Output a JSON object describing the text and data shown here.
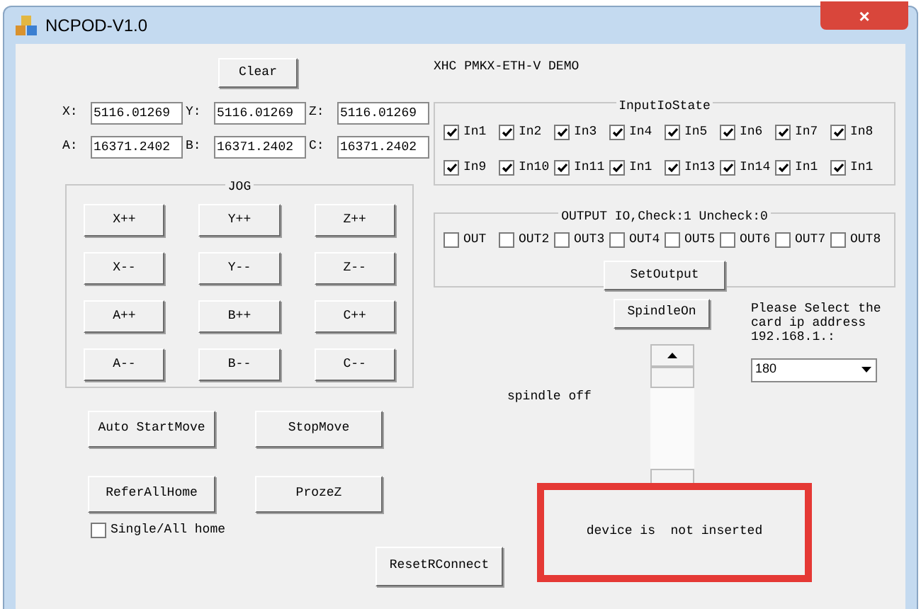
{
  "window": {
    "title": "NCPOD-V1.0",
    "close": "×"
  },
  "clear_button": "Clear",
  "positions": [
    {
      "label": "X:",
      "value": "5116.01269"
    },
    {
      "label": "Y:",
      "value": "5116.01269"
    },
    {
      "label": "Z:",
      "value": "5116.01269"
    },
    {
      "label": "A:",
      "value": "16371.2402"
    },
    {
      "label": "B:",
      "value": "16371.2402"
    },
    {
      "label": "C:",
      "value": "16371.2402"
    }
  ],
  "jog": {
    "title": "JOG",
    "buttons": [
      "X++",
      "Y++",
      "Z++",
      "X--",
      "Y--",
      "Z--",
      "A++",
      "B++",
      "C++",
      "A--",
      "B--",
      "C--"
    ]
  },
  "motion_buttons": [
    "Auto StartMove",
    "StopMove",
    "ReferAllHome",
    "ProzeZ"
  ],
  "single_home": {
    "label": "Single/All home",
    "checked": false
  },
  "reset_button": "ResetRConnect",
  "demo_title": "XHC PMKX-ETH-V DEMO",
  "inputs": {
    "title": "InputIoState",
    "items": [
      {
        "label": "In1",
        "checked": true
      },
      {
        "label": "In2",
        "checked": true
      },
      {
        "label": "In3",
        "checked": true
      },
      {
        "label": "In4",
        "checked": true
      },
      {
        "label": "In5",
        "checked": true
      },
      {
        "label": "In6",
        "checked": true
      },
      {
        "label": "In7",
        "checked": true
      },
      {
        "label": "In8",
        "checked": true
      },
      {
        "label": "In9",
        "checked": true
      },
      {
        "label": "In10",
        "checked": true
      },
      {
        "label": "In11",
        "checked": true
      },
      {
        "label": "In1",
        "checked": true
      },
      {
        "label": "In13",
        "checked": true
      },
      {
        "label": "In14",
        "checked": true
      },
      {
        "label": "In1",
        "checked": true
      },
      {
        "label": "In1",
        "checked": true
      }
    ]
  },
  "outputs": {
    "title": "OUTPUT IO,Check:1 Uncheck:0",
    "items": [
      {
        "label": "OUT",
        "checked": false
      },
      {
        "label": "OUT2",
        "checked": false
      },
      {
        "label": "OUT3",
        "checked": false
      },
      {
        "label": "OUT4",
        "checked": false
      },
      {
        "label": "OUT5",
        "checked": false
      },
      {
        "label": "OUT6",
        "checked": false
      },
      {
        "label": "OUT7",
        "checked": false
      },
      {
        "label": "OUT8",
        "checked": false
      }
    ],
    "button": "SetOutput"
  },
  "spindle_button": "SpindleOn",
  "spindle_status": "spindle off",
  "ip_prompt": "Please Select the card ip address 192.168.1.:",
  "ip_select": {
    "value": "180"
  },
  "device_status": "device is  not inserted"
}
